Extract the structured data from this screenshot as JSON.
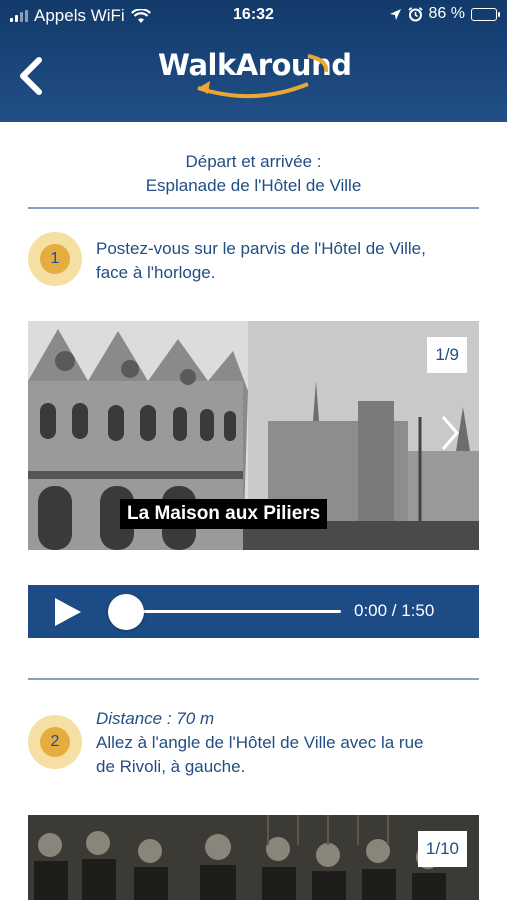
{
  "status_bar": {
    "carrier": "Appels WiFi",
    "time": "16:32",
    "battery_percent": "86 %",
    "battery_level": 0.86
  },
  "header": {
    "app_logo_text": "WalkAround",
    "back_icon": "chevron-left-icon"
  },
  "route": {
    "depart_line1": "Départ et arrivée :",
    "depart_line2": "Esplanade de l'Hôtel de Ville"
  },
  "steps": [
    {
      "number": "1",
      "distance": "",
      "instruction_line1": "Postez-vous sur le parvis de l'Hôtel de Ville,",
      "instruction_line2": "face à l'horloge.",
      "gallery": {
        "counter": "1/9",
        "caption": "La Maison aux Piliers"
      },
      "audio": {
        "time": "0:00 / 1:50",
        "progress": 0
      }
    },
    {
      "number": "2",
      "distance": "Distance : 70 m",
      "instruction_line1": "Allez à l'angle de l'Hôtel de Ville avec la rue",
      "instruction_line2": "de Rivoli, à gauche.",
      "gallery": {
        "counter": "1/10"
      }
    }
  ],
  "colors": {
    "header_blue": "#1d4b86",
    "text_blue": "#234e85",
    "badge_gold": "#e5ad3f",
    "badge_halo": "#f5dfa3",
    "logo_arrow": "#e8a833"
  }
}
